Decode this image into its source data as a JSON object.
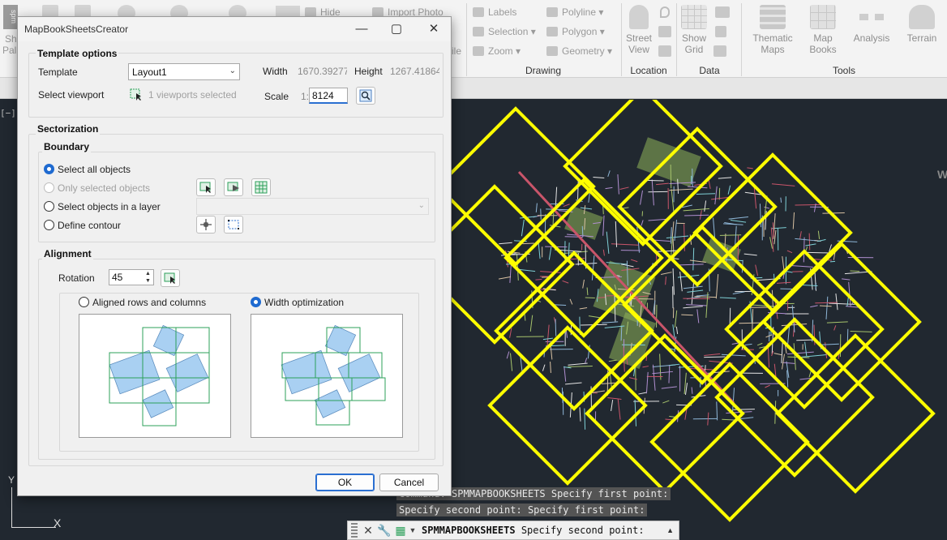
{
  "ribbon": {
    "left_fragments": [
      "spm",
      "Sh",
      "Pal"
    ],
    "row_items": {
      "hide": "Hide",
      "import_photo": "Import Photo",
      "labels": "Labels",
      "selection": "Selection",
      "zoom": "Zoom",
      "polyline": "Polyline",
      "polygon": "Polygon",
      "geometry": "Geometry",
      "ile": "ile"
    },
    "big_buttons": {
      "street_view": "Street View",
      "show_grid": "Show Grid",
      "thematic_maps": "Thematic Maps",
      "map_books": "Map Books",
      "analysis": "Analysis",
      "terrain": "Terrain"
    },
    "groups": {
      "drawing": "Drawing",
      "location": "Location",
      "data": "Data",
      "tools": "Tools"
    }
  },
  "viewport_label": "[−][",
  "edge_letter": "W",
  "ucs": {
    "x": "X",
    "y": "Y"
  },
  "dialog": {
    "title": "MapBookSheetsCreator",
    "template_options": {
      "legend": "Template options",
      "template_label": "Template",
      "template_value": "Layout1",
      "width_label": "Width",
      "width_value": "1670.392778",
      "height_label": "Height",
      "height_value": "1267.418645",
      "select_viewport_label": "Select viewport",
      "viewports_selected": "1 viewports selected",
      "scale_label": "Scale",
      "scale_prefix": "1:",
      "scale_value": "8124"
    },
    "sectorization": {
      "legend": "Sectorization",
      "boundary": {
        "legend": "Boundary",
        "options": [
          "Select all objects",
          "Only selected objects",
          "Select objects in a layer",
          "Define contour"
        ]
      },
      "alignment": {
        "legend": "Alignment",
        "rotation_label": "Rotation",
        "rotation_value": "45",
        "modes": [
          "Aligned rows and columns",
          "Width optimization"
        ]
      }
    },
    "buttons": {
      "ok": "OK",
      "cancel": "Cancel"
    }
  },
  "command_line": {
    "history_1": "Command: SPMMAPBOOKSHEETS Specify first point:",
    "history_2": "Specify second point: Specify first point:",
    "command": "SPMMAPBOOKSHEETS",
    "prompt": "Specify second point:"
  },
  "colors": {
    "canvas": "#212830",
    "sheet_outline": "#ffff00",
    "accent_blue": "#1e6ad0",
    "preview_grid": "#2ca05a",
    "preview_fill": "#a9d0f2"
  }
}
